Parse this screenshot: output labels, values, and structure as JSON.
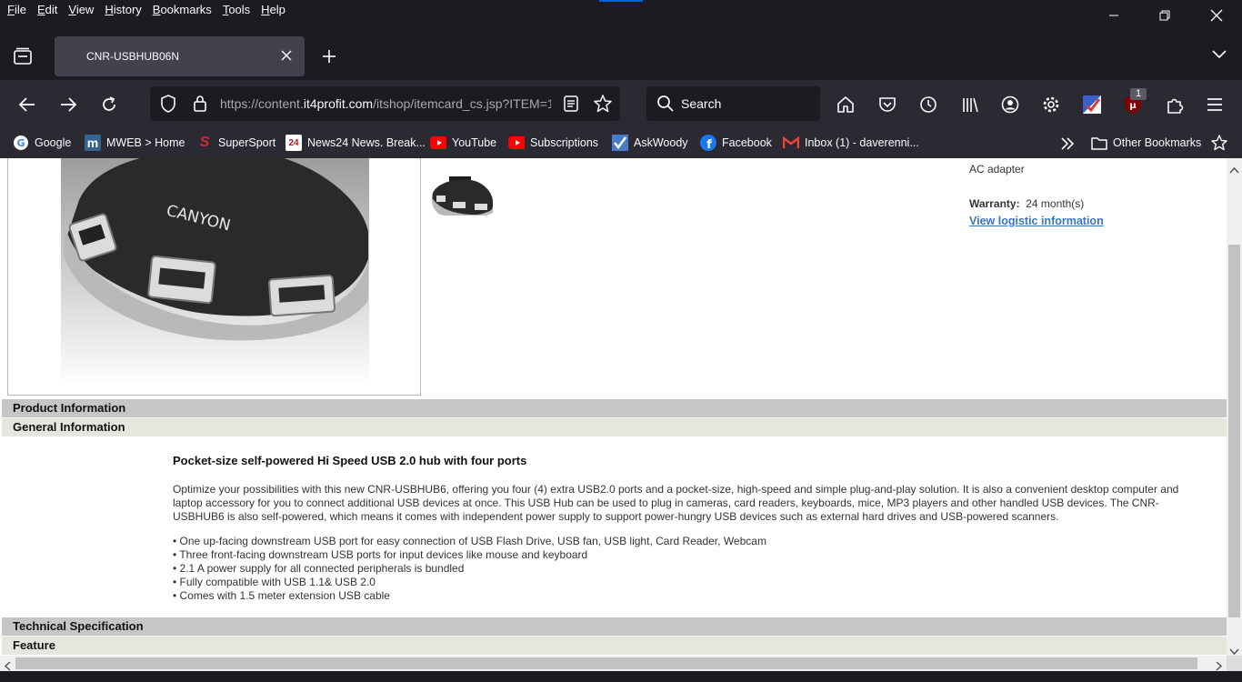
{
  "menubar": {
    "items": [
      {
        "label": "File",
        "key": "F",
        "rest": "ile"
      },
      {
        "label": "Edit",
        "key": "E",
        "rest": "dit"
      },
      {
        "label": "View",
        "key": "V",
        "rest": "iew"
      },
      {
        "label": "History",
        "key": "H",
        "rest": "istory"
      },
      {
        "label": "Bookmarks",
        "key": "B",
        "rest": "ookmarks"
      },
      {
        "label": "Tools",
        "key": "T",
        "rest": "ools"
      },
      {
        "label": "Help",
        "key": "H",
        "rest": "elp"
      }
    ]
  },
  "tab": {
    "title": "CNR-USBHUB06N"
  },
  "urlbar": {
    "prefix": "https://content.",
    "domain": "it4profit.com",
    "path": "/itshop/itemcard_cs.jsp?ITEM=1"
  },
  "search": {
    "placeholder": "Search"
  },
  "extension_badge": "1",
  "bookmarks": [
    {
      "label": "Google"
    },
    {
      "label": "MWEB > Home"
    },
    {
      "label": "SuperSport"
    },
    {
      "label": "News24 News. Break..."
    },
    {
      "label": "YouTube"
    },
    {
      "label": "Subscriptions"
    },
    {
      "label": "AskWoody"
    },
    {
      "label": "Facebook"
    },
    {
      "label": "Inbox (1) - daverenni..."
    }
  ],
  "other_bookmarks": "Other Bookmarks",
  "product": {
    "brand_logo": "CANYON",
    "ac_adapter": "AC adapter",
    "warranty_label": "Warranty:",
    "warranty_value": "24 month(s)",
    "logistic_link": "View logistic information"
  },
  "sections": {
    "product_information": "Product Information",
    "general_information": "General Information",
    "technical_specification": "Technical Specification",
    "feature": "Feature"
  },
  "description": {
    "heading": "Pocket-size self-powered Hi Speed USB 2.0 hub with four ports",
    "paragraph": "Optimize your possibilities with this new CNR-USBHUB6, offering you four (4) extra USB2.0 ports and a pocket-size, high-speed and simple plug-and-play solution. It is also a convenient desktop computer and laptop accessory for you to connect additional USB devices at once. This USB Hub can be used to plug in cameras, card readers, keyboards, mice, MP3 players and other handled USB devices. The CNR-USBHUB6 is also self-powered, which means it comes with independent power supply to support power-hungry USB devices such as external hard drives and USB-powered scanners.",
    "bullets": [
      "• One up-facing downstream USB port for easy connection of USB Flash Drive, USB fan, USB light, Card Reader, Webcam",
      "• Three front-facing downstream USB ports for input devices like mouse and keyboard",
      "• 2.1 A power supply for all connected peripherals is bundled",
      "• Fully compatible with USB 1.1& USB 2.0",
      "• Comes with 1.5 meter extension USB cable"
    ]
  }
}
